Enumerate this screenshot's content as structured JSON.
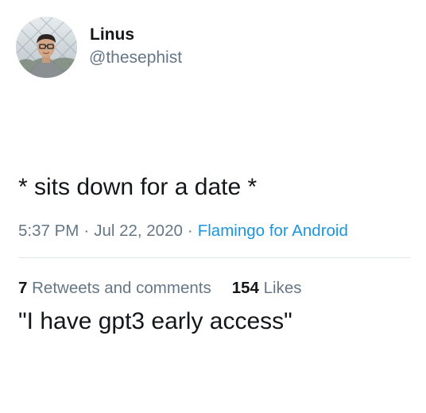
{
  "user": {
    "display_name": "Linus",
    "handle": "@thesephist"
  },
  "tweet": {
    "line1": "* sits down for a date *",
    "line2": "\"I have gpt3 early access\""
  },
  "meta": {
    "time": "5:37 PM",
    "separator": "·",
    "date": "Jul 22, 2020",
    "source": "Flamingo for Android"
  },
  "stats": {
    "retweets_count": "7",
    "retweets_label": "Retweets and comments",
    "likes_count": "154",
    "likes_label": "Likes"
  },
  "colors": {
    "text": "#14171a",
    "secondary": "#657786",
    "link": "#1b95e0",
    "divider": "#e1e8ed"
  },
  "icons": {
    "avatar": "user-avatar-photo"
  }
}
